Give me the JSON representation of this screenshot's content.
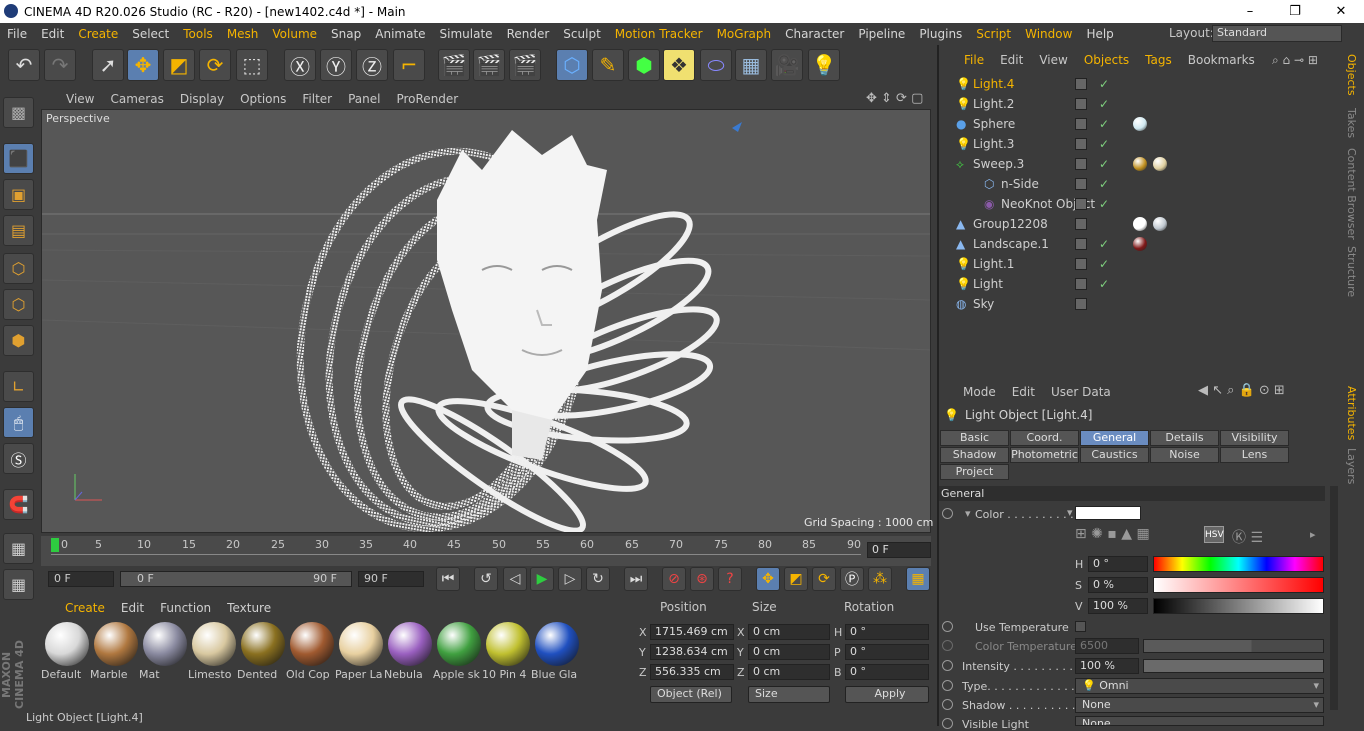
{
  "window": {
    "title": "CINEMA 4D R20.026 Studio (RC - R20) - [new1402.c4d *] - Main"
  },
  "menubar": {
    "items": [
      "File",
      "Edit",
      "Create",
      "Select",
      "Tools",
      "Mesh",
      "Volume",
      "Snap",
      "Animate",
      "Simulate",
      "Render",
      "Sculpt",
      "Motion Tracker",
      "MoGraph",
      "Character",
      "Pipeline",
      "Plugins",
      "Script",
      "Window",
      "Help"
    ],
    "layout_label": "Layout:",
    "layout_value": "Standard"
  },
  "toolbar": {
    "icons": [
      "undo-icon",
      "redo-icon",
      "select-icon",
      "move-icon",
      "scale-icon",
      "rotate-icon",
      "recent-icon",
      "x-axis-icon",
      "y-axis-icon",
      "z-axis-icon",
      "coordinate-system-icon",
      "render-view-icon",
      "render-picture-viewer-icon",
      "edit-render-settings-icon",
      "cube-icon",
      "pen-icon",
      "subdivision-icon",
      "array-icon",
      "deformer-icon",
      "floor-icon",
      "camera-icon",
      "light-icon"
    ]
  },
  "viewport": {
    "menu": [
      "View",
      "Cameras",
      "Display",
      "Options",
      "Filter",
      "Panel",
      "ProRender"
    ],
    "label": "Perspective",
    "grid_spacing": "Grid Spacing : 1000 cm"
  },
  "timeline": {
    "ticks": [
      "0",
      "5",
      "10",
      "15",
      "20",
      "25",
      "30",
      "35",
      "40",
      "45",
      "50",
      "55",
      "60",
      "65",
      "70",
      "75",
      "80",
      "85",
      "90"
    ],
    "current_frame": "0 F",
    "start_frame": "0 F",
    "range_start": "0 F",
    "range_end": "90 F",
    "end_frame": "90 F"
  },
  "materials": {
    "menu": [
      "Create",
      "Edit",
      "Function",
      "Texture"
    ],
    "items": [
      {
        "name": "Default",
        "color": "#d8d8d8"
      },
      {
        "name": "Marble",
        "color": "#b07840"
      },
      {
        "name": "Mat",
        "color": "#8a8aa0"
      },
      {
        "name": "Limesto",
        "color": "#d8c8a0"
      },
      {
        "name": "Dented",
        "color": "#8a7020"
      },
      {
        "name": "Old Cop",
        "color": "#a05a30"
      },
      {
        "name": "Paper La",
        "color": "#e8d0a0"
      },
      {
        "name": "Nebula",
        "color": "#9a60c0"
      },
      {
        "name": "Apple sk",
        "color": "#40a040"
      },
      {
        "name": "10 Pin 4",
        "color": "#c0c030"
      },
      {
        "name": "Blue Gla",
        "color": "#2050c0"
      }
    ]
  },
  "coordinates": {
    "headers": [
      "Position",
      "Size",
      "Rotation"
    ],
    "rows": [
      {
        "axis": "X",
        "pos": "1715.469 cm",
        "size_axis": "X",
        "size": "0 cm",
        "rot_axis": "H",
        "rot": "0 °"
      },
      {
        "axis": "Y",
        "pos": "1238.634 cm",
        "size_axis": "Y",
        "size": "0 cm",
        "rot_axis": "P",
        "rot": "0 °"
      },
      {
        "axis": "Z",
        "pos": "556.335 cm",
        "size_axis": "Z",
        "size": "0 cm",
        "rot_axis": "B",
        "rot": "0 °"
      }
    ],
    "mode": "Object (Rel)",
    "size_mode": "Size",
    "apply": "Apply"
  },
  "objects": {
    "menu": [
      "File",
      "Edit",
      "View",
      "Objects",
      "Tags",
      "Bookmarks"
    ],
    "items": [
      {
        "name": "Light.4",
        "icon": "light-icon",
        "selected": true,
        "check": true,
        "tags": []
      },
      {
        "name": "Light.2",
        "icon": "light-icon",
        "selected": false,
        "check": true,
        "tags": []
      },
      {
        "name": "Sphere",
        "icon": "sphere-icon",
        "selected": false,
        "check": true,
        "tags": [
          "#cfe8f0"
        ]
      },
      {
        "name": "Light.3",
        "icon": "light-icon",
        "selected": false,
        "check": true,
        "tags": []
      },
      {
        "name": "Sweep.3",
        "icon": "sweep-icon",
        "selected": false,
        "check": true,
        "tags": [
          "#c09020",
          "#e0d0a0"
        ]
      },
      {
        "name": "n-Side",
        "icon": "nside-icon",
        "selected": false,
        "check": true,
        "tags": []
      },
      {
        "name": "NeoKnot Object",
        "icon": "neoknot-icon",
        "selected": false,
        "check": true,
        "tags": []
      },
      {
        "name": "Group12208",
        "icon": "group-icon",
        "selected": false,
        "check": false,
        "tags": [
          "#ffffff",
          "#c0c8d0"
        ]
      },
      {
        "name": "Landscape.1",
        "icon": "landscape-icon",
        "selected": false,
        "check": true,
        "tags": [
          "#801818"
        ]
      },
      {
        "name": "Light.1",
        "icon": "light-icon",
        "selected": false,
        "check": true,
        "tags": []
      },
      {
        "name": "Light",
        "icon": "light-icon",
        "selected": false,
        "check": true,
        "tags": []
      },
      {
        "name": "Sky",
        "icon": "sky-icon",
        "selected": false,
        "check": false,
        "tags": []
      }
    ]
  },
  "side_tabs": [
    "Objects",
    "Takes",
    "Content Browser",
    "Structure",
    "Attributes",
    "Layers"
  ],
  "attributes": {
    "menu": [
      "Mode",
      "Edit",
      "User Data"
    ],
    "title": "Light Object [Light.4]",
    "tabs_row1": [
      "Basic",
      "Coord.",
      "General",
      "Details",
      "Visibility"
    ],
    "tabs_row2": [
      "Shadow",
      "Photometric",
      "Caustics",
      "Noise",
      "Lens"
    ],
    "tabs_row3": [
      "Project"
    ],
    "active_tab": "General",
    "section": "General",
    "color_label": "Color . . . . . . . . . .",
    "h_label": "H",
    "h_value": "0 °",
    "s_label": "S",
    "s_value": "0 %",
    "v_label": "V",
    "v_value": "100 %",
    "use_temp_label": "Use Temperature",
    "color_temp_label": "Color Temperature",
    "color_temp_value": "6500",
    "intensity_label": "Intensity . . . . . . . . . .",
    "intensity_value": "100 %",
    "type_label": "Type. . . . . . . . . . . . .",
    "type_value": "Omni",
    "shadow_label": "Shadow . . . . . . . . . .",
    "shadow_value": "None",
    "visible_light_label": "Visible Light",
    "visible_light_value": "None",
    "hsv_mode": "HSV"
  },
  "status": {
    "text": "Light Object [Light.4]"
  },
  "colors": {
    "accent": "#f5b400",
    "active_blue": "#5b7fb0",
    "viewport_bg": "#575757"
  }
}
